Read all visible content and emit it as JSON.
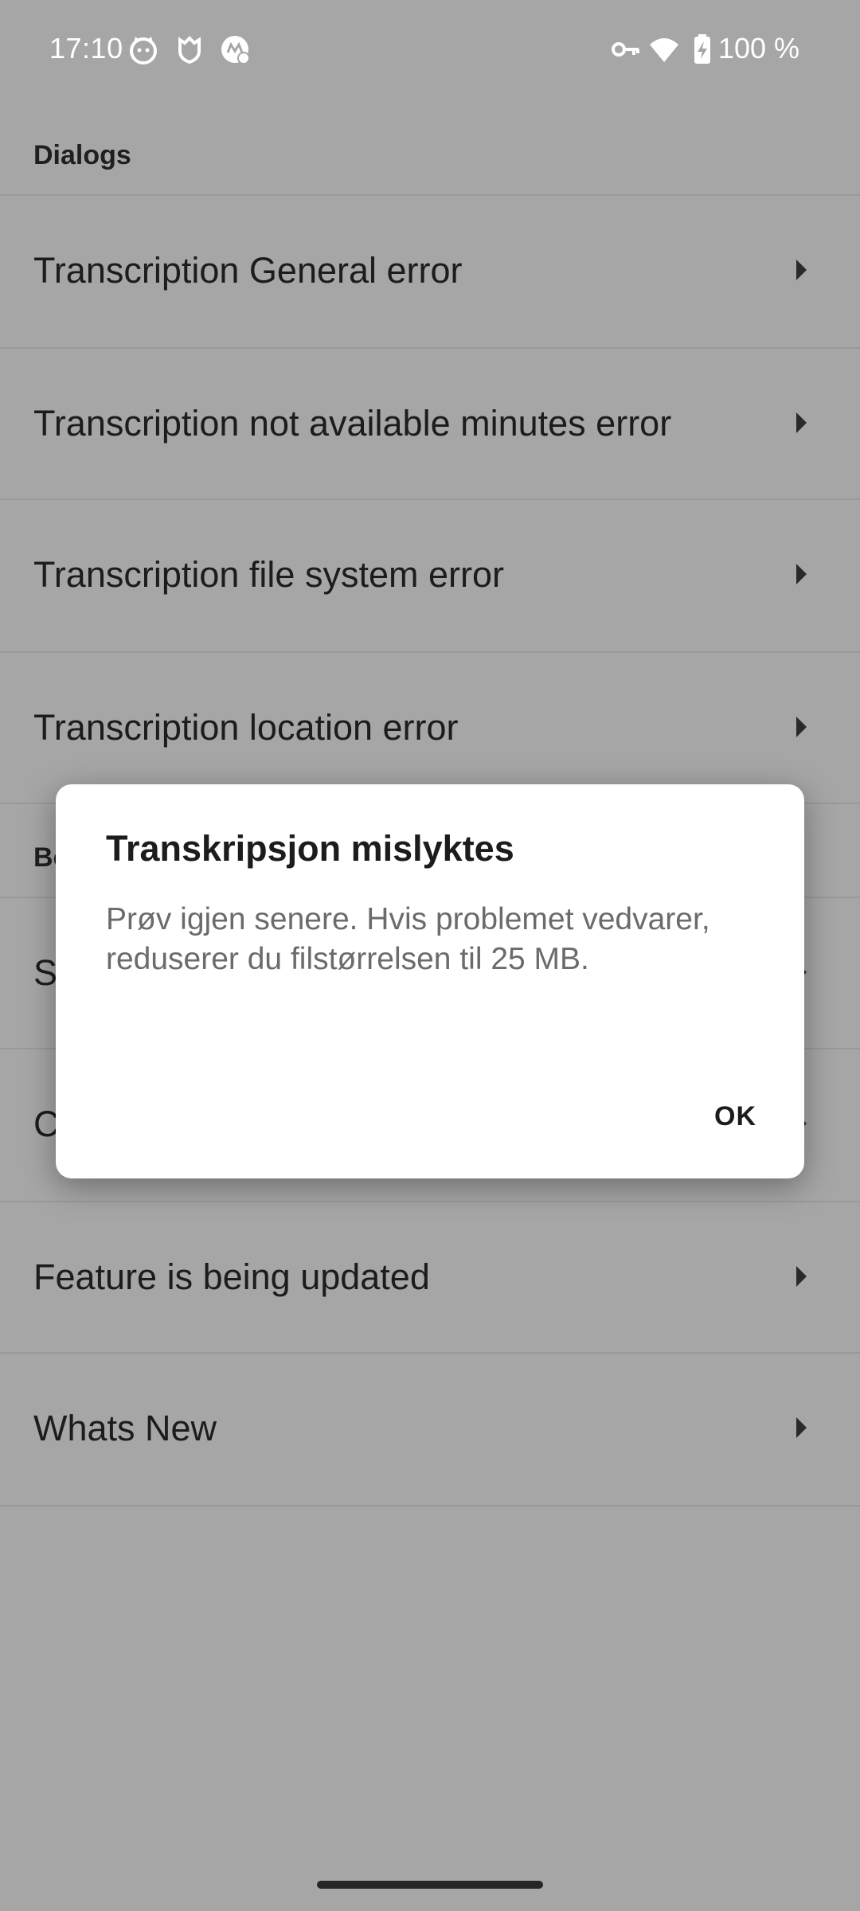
{
  "status_bar": {
    "time": "17:10",
    "battery_text": "100 %",
    "left_icons": [
      "cat-face-icon",
      "shield-check-icon",
      "app-badge-icon"
    ],
    "right_icons": [
      "vpn-key-icon",
      "wifi-icon",
      "battery-charging-icon"
    ]
  },
  "sections": {
    "dialogs_header": "Dialogs",
    "second_header_partial": "Bo"
  },
  "list_items": [
    {
      "label": "Transcription General error"
    },
    {
      "label": "Transcription not available minutes error"
    },
    {
      "label": "Transcription file system error"
    },
    {
      "label": "Transcription location error"
    },
    {
      "label": "S"
    },
    {
      "label": "C"
    },
    {
      "label": "Feature is being updated"
    },
    {
      "label": "Whats New"
    }
  ],
  "dialog": {
    "title": "Transkripsjon mislyktes",
    "message": "Prøv igjen senere. Hvis problemet vedvarer, reduserer du filstørrelsen til 25 MB.",
    "ok_label": "OK"
  },
  "colors": {
    "scrim_background": "#a6a6a6",
    "dialog_background": "#ffffff",
    "text_primary": "#1c1c1c",
    "text_secondary": "#6b6b6b"
  }
}
